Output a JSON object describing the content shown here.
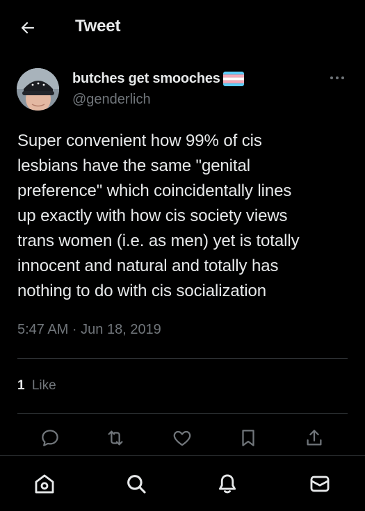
{
  "header": {
    "title": "Tweet",
    "back_icon": "arrow-left-icon"
  },
  "author": {
    "display_name": "butches get smooches",
    "handle": "@genderlich",
    "flag_icon": "transgender-flag-icon",
    "flag_colors": [
      "#5bcefa",
      "#f5a9b8",
      "#ffffff",
      "#f5a9b8",
      "#5bcefa"
    ]
  },
  "tweet": {
    "lines": [
      "Super convenient how 99% of cis",
      "lesbians have the same \"genital",
      "preference\" which coincidentally lines",
      "up exactly with how cis society views",
      "trans women (i.e. as men) yet is totally",
      "innocent and natural and totally has",
      "nothing to do with cis socialization"
    ],
    "timestamp": "5:47 AM · Jun 18, 2019",
    "likes_count": "1",
    "likes_label": "Like"
  },
  "actions": [
    "reply-icon",
    "retweet-icon",
    "like-icon",
    "bookmark-icon",
    "share-icon"
  ],
  "bottom_nav": [
    "home-icon",
    "search-icon",
    "notifications-icon",
    "messages-icon"
  ],
  "colors": {
    "background": "#000000",
    "text_primary": "#e7e9ea",
    "text_secondary": "#71767b",
    "divider": "#2f3336"
  }
}
